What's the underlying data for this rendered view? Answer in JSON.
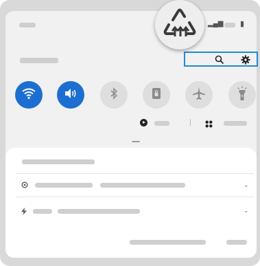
{
  "colors": {
    "accent": "#1c6fd1",
    "callout_border": "#1f8bd6"
  },
  "quick_panel": {
    "tiles": [
      {
        "icon": "wifi-icon",
        "state": "on"
      },
      {
        "icon": "sound-icon",
        "state": "on"
      },
      {
        "icon": "bluetooth-icon",
        "state": "off"
      },
      {
        "icon": "lock-rotation-icon",
        "state": "off"
      },
      {
        "icon": "airplane-icon",
        "state": "off"
      },
      {
        "icon": "flashlight-icon",
        "state": "off"
      }
    ],
    "media_icon": "play-icon",
    "devices_icon": "grid-icon"
  },
  "header_icons": [
    "search-icon",
    "gear-icon"
  ],
  "notifications": {
    "rows": [
      {
        "icon": "sync-icon"
      },
      {
        "icon": "bolt-icon"
      }
    ]
  },
  "logo_icon": "recycle-arrows-icon"
}
